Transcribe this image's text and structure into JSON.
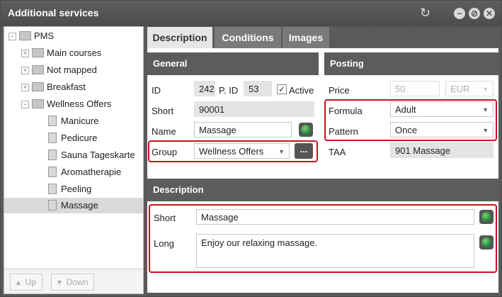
{
  "window": {
    "title": "Additional services"
  },
  "tree": {
    "items": [
      {
        "label": "PMS",
        "type": "folder"
      },
      {
        "label": "Main courses",
        "type": "folder"
      },
      {
        "label": "Not mapped",
        "type": "folder"
      },
      {
        "label": "Breakfast",
        "type": "folder"
      },
      {
        "label": "Wellness Offers",
        "type": "folder"
      },
      {
        "label": "Manicure",
        "type": "doc"
      },
      {
        "label": "Pedicure",
        "type": "doc"
      },
      {
        "label": "Sauna Tageskarte",
        "type": "doc"
      },
      {
        "label": "Aromatherapie",
        "type": "doc"
      },
      {
        "label": "Peeling",
        "type": "doc"
      },
      {
        "label": "Massage",
        "type": "doc"
      }
    ],
    "up_label": "Up",
    "down_label": "Down"
  },
  "tabs": [
    {
      "label": "Description"
    },
    {
      "label": "Conditions"
    },
    {
      "label": "Images"
    }
  ],
  "general": {
    "title": "General",
    "id_label": "ID",
    "id_value": "242",
    "pid_label": "P. ID",
    "pid_value": "53",
    "active_label": "Active",
    "short_label": "Short",
    "short_value": "90001",
    "name_label": "Name",
    "name_value": "Massage",
    "group_label": "Group",
    "group_value": "Wellness Offers",
    "group_btn": "..."
  },
  "posting": {
    "title": "Posting",
    "price_label": "Price",
    "price_value": "50",
    "currency_value": "EUR",
    "formula_label": "Formula",
    "formula_value": "Adult",
    "pattern_label": "Pattern",
    "pattern_value": "Once",
    "taa_label": "TAA",
    "taa_value": "901 Massage"
  },
  "description": {
    "title": "Description",
    "short_label": "Short",
    "short_value": "Massage",
    "long_label": "Long",
    "long_value": "Enjoy our relaxing massage."
  }
}
